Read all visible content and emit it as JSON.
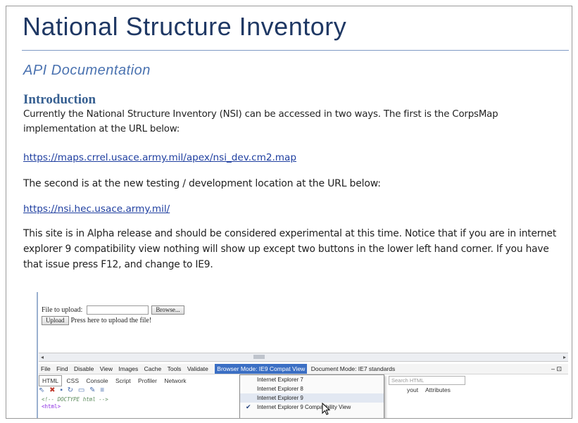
{
  "doc": {
    "title": "National Structure Inventory",
    "subtitle": "API Documentation",
    "intro_heading": "Introduction",
    "para1": "Currently the National Structure Inventory (NSI) can be accessed in two ways.  The first is the CorpsMap implementation at the URL below:",
    "link1": "https://maps.crrel.usace.army.mil/apex/nsi_dev.cm2.map",
    "para2": "The second is at the new testing / development location at the URL below:",
    "link2": "https://nsi.hec.usace.army.mil/",
    "para3": "This site is in Alpha release and should be considered experimental at this time.  Notice that if you are in internet explorer 9 compatibility view nothing will show up except two buttons in the lower left hand corner.  If you have that issue press F12, and change to IE9."
  },
  "screenshot": {
    "file_label": "File to upload:",
    "browse_label": "Browse...",
    "upload_label": "Upload",
    "upload_hint": "Press here to upload the file!",
    "menu": [
      "File",
      "Find",
      "Disable",
      "View",
      "Images",
      "Cache",
      "Tools",
      "Validate"
    ],
    "browser_mode": "Browser Mode: IE9 Compat View",
    "document_mode": "Document Mode: IE7 standards",
    "window_controls": "– ⊡",
    "tabs": [
      "HTML",
      "CSS",
      "Console",
      "Script",
      "Profiler",
      "Network"
    ],
    "search_placeholder": "Search HTML",
    "right_tabs": [
      "yout",
      "Attributes"
    ],
    "code_line1": "<!-- DOCTYPE html -->",
    "code_line2": "<html>",
    "dropdown": [
      "Internet Explorer 7",
      "Internet Explorer 8",
      "Internet Explorer 9",
      "Internet Explorer 9 Compatibility View"
    ],
    "selected_index": 3,
    "hover_index": 2,
    "scroll_mark": "==="
  }
}
